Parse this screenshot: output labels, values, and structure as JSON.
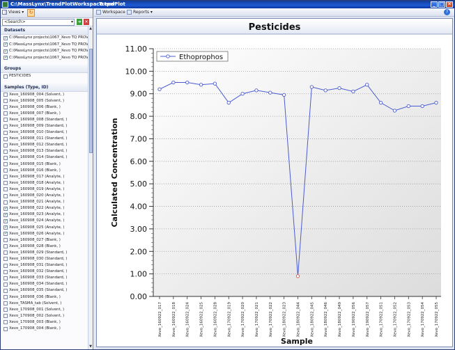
{
  "window": {
    "title_left": "C:\\MassLynx\\TrendPlotWorkspace.tpw",
    "title_right": "TrendPlot",
    "min": "_",
    "max": "□",
    "close": "✕"
  },
  "left_pane": {
    "views_label": "Views ▾",
    "search_placeholder": "<Search>",
    "datasets_header": "Datasets",
    "datasets": [
      {
        "label": "C:\\MassLynx projects\\1067_Xevo TQ PROV\\",
        "checked": true
      },
      {
        "label": "C:\\MassLynx projects\\1067_Xevo TQ PROV\\",
        "checked": true
      },
      {
        "label": "C:\\MassLynx projects\\1067_Xevo TQ PROV\\",
        "checked": true
      },
      {
        "label": "C:\\MassLynx projects\\1067_Xevo TQ PROV\\",
        "checked": true
      }
    ],
    "groups_header": "Groups",
    "groups": [
      {
        "label": "PESTICIDES",
        "checked": false
      }
    ],
    "samples_header": "Samples (Type, ID)",
    "samples": [
      {
        "label": "Xevo_160908_004 (Solvent, )",
        "checked": false
      },
      {
        "label": "Xevo_160908_005 (Solvent, )",
        "checked": false
      },
      {
        "label": "Xevo_160908_006 (Blank, )",
        "checked": false
      },
      {
        "label": "Xevo_160908_007 (Blank, )",
        "checked": false
      },
      {
        "label": "Xevo_160908_008 (Standard, )",
        "checked": false
      },
      {
        "label": "Xevo_160908_009 (Standard, )",
        "checked": false
      },
      {
        "label": "Xevo_160908_010 (Standard, )",
        "checked": false
      },
      {
        "label": "Xevo_160908_011 (Standard, )",
        "checked": false
      },
      {
        "label": "Xevo_160908_012 (Standard, )",
        "checked": false
      },
      {
        "label": "Xevo_160908_013 (Standard, )",
        "checked": false
      },
      {
        "label": "Xevo_160908_014 (Standard, )",
        "checked": false
      },
      {
        "label": "Xevo_160908_015 (Blank, )",
        "checked": false
      },
      {
        "label": "Xevo_160908_016 (Blank, )",
        "checked": false
      },
      {
        "label": "Xevo_160908_017 (Analyte, )",
        "checked": false
      },
      {
        "label": "Xevo_160908_018 (Analyte, )",
        "checked": false
      },
      {
        "label": "Xevo_160908_019 (Analyte, )",
        "checked": false
      },
      {
        "label": "Xevo_160908_020 (Analyte, )",
        "checked": false
      },
      {
        "label": "Xevo_160908_021 (Analyte, )",
        "checked": false
      },
      {
        "label": "Xevo_160908_022 (Analyte, )",
        "checked": true
      },
      {
        "label": "Xevo_160908_023 (Analyte, )",
        "checked": true
      },
      {
        "label": "Xevo_160908_024 (Analyte, )",
        "checked": true
      },
      {
        "label": "Xevo_160908_025 (Analyte, )",
        "checked": true
      },
      {
        "label": "Xevo_160908_026 (Analyte, )",
        "checked": true
      },
      {
        "label": "Xevo_160908_027 (Blank, )",
        "checked": false
      },
      {
        "label": "Xevo_160908_028 (Blank, )",
        "checked": false
      },
      {
        "label": "Xevo_160908_029 (Standard, )",
        "checked": false
      },
      {
        "label": "Xevo_160908_030 (Standard, )",
        "checked": false
      },
      {
        "label": "Xevo_160908_031 (Standard, )",
        "checked": false
      },
      {
        "label": "Xevo_160908_032 (Standard, )",
        "checked": false
      },
      {
        "label": "Xevo_160908_033 (Standard, )",
        "checked": false
      },
      {
        "label": "Xevo_160908_034 (Standard, )",
        "checked": false
      },
      {
        "label": "Xevo_160908_035 (Standard, )",
        "checked": false
      },
      {
        "label": "Xevo_160908_036 (Blank, )",
        "checked": false
      },
      {
        "label": "Xevo_TASMA_tab (Solvent, )",
        "checked": false
      },
      {
        "label": "Xevo_170908_001 (Solvent, )",
        "checked": false
      },
      {
        "label": "Xevo_170908_002 (Solvent, )",
        "checked": false
      },
      {
        "label": "Xevo_170908_003 (Blank, )",
        "checked": false
      },
      {
        "label": "Xevo_170908_004 (Blank, )",
        "checked": false
      }
    ]
  },
  "right_pane": {
    "workspace_label": "Workspace ▾",
    "reports_label": "Reports ▾",
    "help": "?"
  },
  "chart_data": {
    "type": "line",
    "title": "Pesticides",
    "xlabel": "Sample",
    "ylabel": "Calculated Concentration",
    "ylim": [
      0,
      11
    ],
    "y_ticks": [
      "0.00",
      "1.00",
      "2.00",
      "3.00",
      "4.00",
      "5.00",
      "6.00",
      "7.00",
      "8.00",
      "9.00",
      "10.00",
      "11.00"
    ],
    "grid": "horizontal dotted",
    "legend_position": "top-left",
    "categories": [
      "Xevo_160922_017",
      "Xevo_160922_018",
      "Xevo_160922_024",
      "Xevo_160922_025",
      "Xevo_160922_028",
      "Xevo_170922_019",
      "Xevo_170922_020",
      "Xevo_170922_021",
      "Xevo_170922_022",
      "Xevo_180922_023",
      "Xevo_180922_044",
      "Xevo_180922_045",
      "Xevo_180922_046",
      "Xevo_180922_049",
      "Xevo_190922_056",
      "Xevo_190922_057",
      "Xevo_170922_051",
      "Xevo_170922_052",
      "Xevo_170922_053",
      "Xevo_170922_054",
      "Xevo_170922_055"
    ],
    "series": [
      {
        "name": "Ethoprophos",
        "color": "#4a5bd0",
        "values": [
          9.2,
          9.5,
          9.5,
          9.4,
          9.45,
          8.6,
          9.0,
          9.15,
          9.05,
          8.95,
          0.9,
          9.3,
          9.15,
          9.25,
          9.1,
          9.4,
          8.6,
          8.25,
          8.45,
          8.45,
          8.6
        ],
        "highlight_index": 10,
        "highlight_color": "#e0504a"
      }
    ]
  }
}
